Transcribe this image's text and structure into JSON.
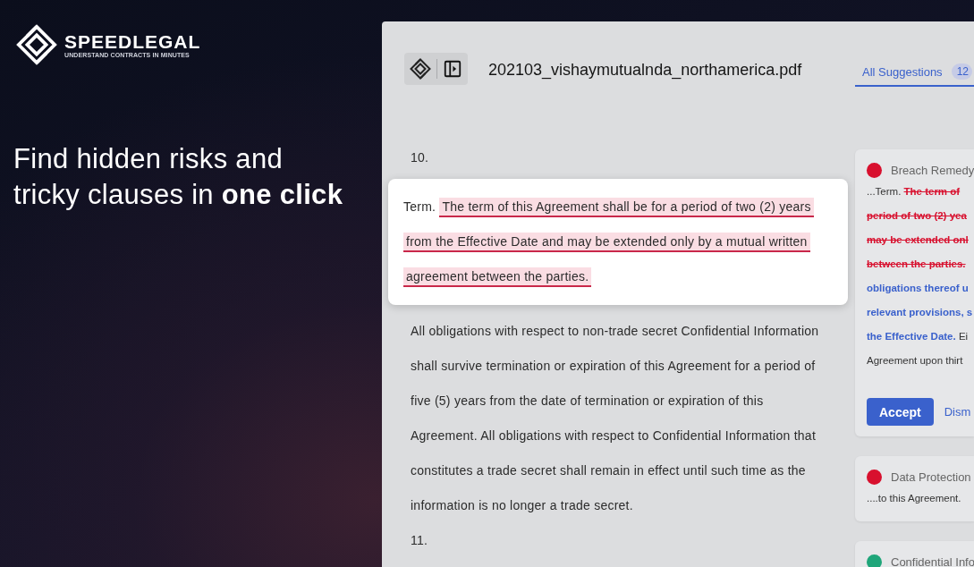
{
  "brand": {
    "name": "SPEEDLEGAL",
    "slogan": "UNDERSTAND CONTRACTS IN MINUTES"
  },
  "headline": "Find hidden risks and\ntricky clauses in **one click**",
  "document": {
    "filename": "202103_vishaymutualnda_northamerica.pdf",
    "tabs": [
      {
        "label": "All Suggestions",
        "count": "12",
        "selected": true
      }
    ],
    "sections": [
      {
        "kind": "number",
        "text": "10."
      },
      {
        "kind": "highlight",
        "lead": "Term.",
        "lines": [
          "The term of this Agreement shall be for a period of two (2) years",
          "from the Effective Date and may be extended only by a mutual written",
          "agreement between the parties."
        ]
      },
      {
        "kind": "paragraph",
        "lines": [
          "All obligations with respect to non-trade secret Confidential Information",
          "shall survive termination or expiration of this Agreement for a period of",
          "five (5) years from the date of termination or expiration of this",
          "Agreement. All obligations with respect to Confidential Information that",
          "constitutes a trade secret shall remain in effect until such time as the",
          "information is no longer a trade secret."
        ]
      },
      {
        "kind": "number",
        "text": "11."
      }
    ]
  },
  "suggestions": [
    {
      "title": "Breach Remedy",
      "color": "#d8102e",
      "lines": [
        [
          {
            "kind": "plain",
            "text": "...Term. "
          },
          {
            "kind": "deleted",
            "text": "The term of"
          }
        ],
        [
          {
            "kind": "deleted",
            "text": "period of two (2) yea"
          }
        ],
        [
          {
            "kind": "deleted",
            "text": "may be extended onl"
          }
        ],
        [
          {
            "kind": "deleted",
            "text": "between the parties."
          }
        ],
        [
          {
            "kind": "inserted",
            "text": "obligations thereof u"
          }
        ],
        [
          {
            "kind": "inserted",
            "text": "relevant provisions, s"
          }
        ],
        [
          {
            "kind": "inserted",
            "text": "the Effective Date."
          },
          {
            "kind": "plain",
            "text": " Ei"
          }
        ],
        [
          {
            "kind": "plain",
            "text": "Agreement upon thirt"
          }
        ]
      ],
      "buttons": [
        {
          "kind": "primary",
          "label": "Accept"
        },
        {
          "kind": "link",
          "label": "Dism"
        }
      ]
    },
    {
      "title": "Data Protection",
      "color": "#d8102e",
      "lines": [
        [
          {
            "kind": "plain",
            "text": "....to this Agreement."
          }
        ]
      ]
    },
    {
      "title": "Confidential Info",
      "color": "#1fa67a"
    }
  ]
}
